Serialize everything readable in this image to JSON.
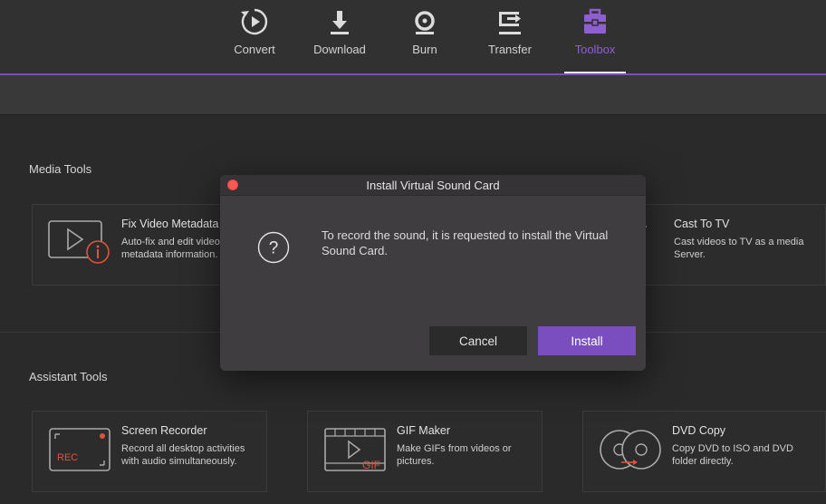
{
  "nav": [
    {
      "label": "Convert",
      "icon": "convert-icon"
    },
    {
      "label": "Download",
      "icon": "download-icon"
    },
    {
      "label": "Burn",
      "icon": "burn-icon"
    },
    {
      "label": "Transfer",
      "icon": "transfer-icon"
    },
    {
      "label": "Toolbox",
      "icon": "toolbox-icon",
      "active": true
    }
  ],
  "colors": {
    "accent": "#7b4ec0",
    "accent_text": "#8d5fd3",
    "rec_red": "#e0523a",
    "close_red": "#fc5753"
  },
  "media_tools": {
    "title": "Media Tools",
    "cards": [
      {
        "title": "Fix Video Metadata",
        "desc": "Auto-fix and edit video metadata information.",
        "icon": "fix-metadata-icon"
      },
      {
        "title": "Cast To TV",
        "desc": "Cast videos to TV as a media Server.",
        "icon": "cast-tv-icon"
      }
    ]
  },
  "assistant_tools": {
    "title": "Assistant Tools",
    "cards": [
      {
        "title": "Screen Recorder",
        "desc": "Record all desktop activities with audio simultaneously.",
        "icon": "screen-recorder-icon",
        "badge": "REC"
      },
      {
        "title": "GIF Maker",
        "desc": "Make GIFs from videos or pictures.",
        "icon": "gif-maker-icon",
        "badge": "GIF"
      },
      {
        "title": "DVD Copy",
        "desc": "Copy DVD to ISO and DVD folder directly.",
        "icon": "dvd-copy-icon"
      }
    ]
  },
  "dialog": {
    "title": "Install Virtual Sound Card",
    "question_glyph": "?",
    "message": "To record the sound, it is requested to install the Virtual Sound Card.",
    "cancel_label": "Cancel",
    "install_label": "Install"
  }
}
